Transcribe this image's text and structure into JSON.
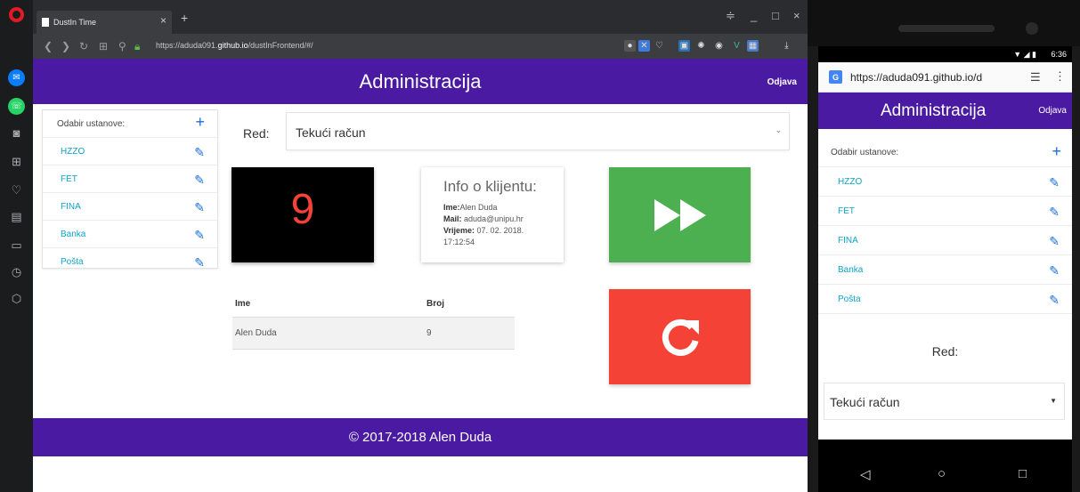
{
  "browser": {
    "tab_title": "DustIn Time",
    "tab_close": "×",
    "new_tab": "+",
    "url_prefix": "https://aduda091.",
    "url_host": "github.io",
    "url_suffix": "/dustInFrontend/#/",
    "minimize": "_",
    "maximize": "□",
    "close": "×"
  },
  "app": {
    "title": "Administracija",
    "logout": "Odjava",
    "institutions_header": "Odabir ustanove:",
    "institutions": [
      "HZZO",
      "FET",
      "FINA",
      "Banka",
      "Pošta"
    ],
    "queue_label": "Red:",
    "queue_selected": "Tekući račun",
    "current_number": "9",
    "client_info": {
      "title": "Info o klijentu:",
      "name_label": "Ime:",
      "name": "Alen Duda",
      "mail_label": "Mail:",
      "mail": "aduda@unipu.hr",
      "time_label": "Vrijeme:",
      "time_line1": "07. 02. 2018.",
      "time_line2": "17:12:54"
    },
    "table": {
      "headers": [
        "Ime",
        "Broj"
      ],
      "rows": [
        [
          "Alen Duda",
          "9"
        ]
      ]
    },
    "footer": "© 2017-2018 Alen Duda"
  },
  "phone": {
    "time": "6:36",
    "url": "https://aduda091.github.io/d",
    "title": "Administracija",
    "logout": "Odjava",
    "institutions_header": "Odabir ustanove:",
    "institutions": [
      "HZZO",
      "FET",
      "FINA",
      "Banka",
      "Pošta"
    ],
    "queue_label": "Red:",
    "queue_selected": "Tekući račun"
  },
  "colors": {
    "brand": "#4a1aa3",
    "next": "#4caf50",
    "reset": "#f44336",
    "link": "#0fa3c8"
  }
}
